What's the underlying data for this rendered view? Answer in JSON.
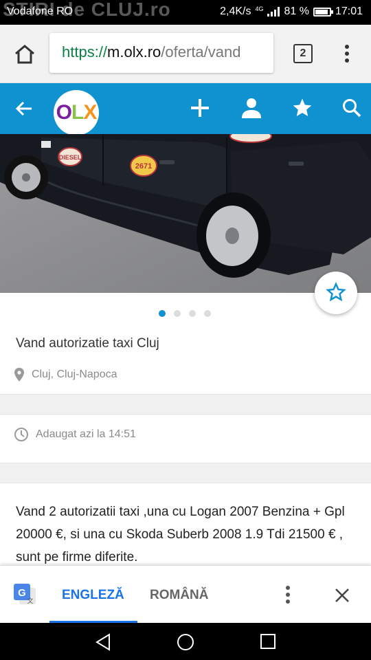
{
  "status_bar": {
    "carrier": "Vodafone RO",
    "watermark": "STIRI de CLUJ.ro",
    "speed": "2,4K/s",
    "network": "4G",
    "battery": "81 %",
    "battery_level": 0.81,
    "time": "17:01"
  },
  "browser": {
    "url_scheme": "https://",
    "url_host": "m.olx.ro",
    "url_path": "/oferta/vand",
    "tab_count": "2",
    "icons": [
      "home-icon",
      "tabs-icon",
      "menu-dots-icon"
    ]
  },
  "olx_header": {
    "logo_letters": [
      "O",
      "L",
      "X"
    ],
    "logo_colors": [
      "#7a1fa2",
      "#8bc34a",
      "#f7941d"
    ],
    "accent": "#1192d0",
    "icons": [
      "back-arrow-icon",
      "add-icon",
      "account-icon",
      "star-icon",
      "search-icon"
    ]
  },
  "gallery": {
    "image": "black car with taxi stickers",
    "sticker_number": "2671",
    "sticker_text": "DIESEL",
    "dots": 4,
    "active_dot": 0
  },
  "listing": {
    "title": "Vand autorizatie taxi Cluj",
    "location": "Cluj, Cluj-Napoca",
    "added": "Adaugat azi la 14:51",
    "description": "Vand 2 autorizatii taxi ,una cu Logan 2007 Benzina + Gpl 20000 €, si una cu Skoda Suberb 2008 1.9 Tdi 21500 € , sunt pe firme diferite."
  },
  "translate_bar": {
    "tab_english": "ENGLEZĂ",
    "tab_romanian": "ROMÂNĂ",
    "accent": "#1a73e8"
  }
}
